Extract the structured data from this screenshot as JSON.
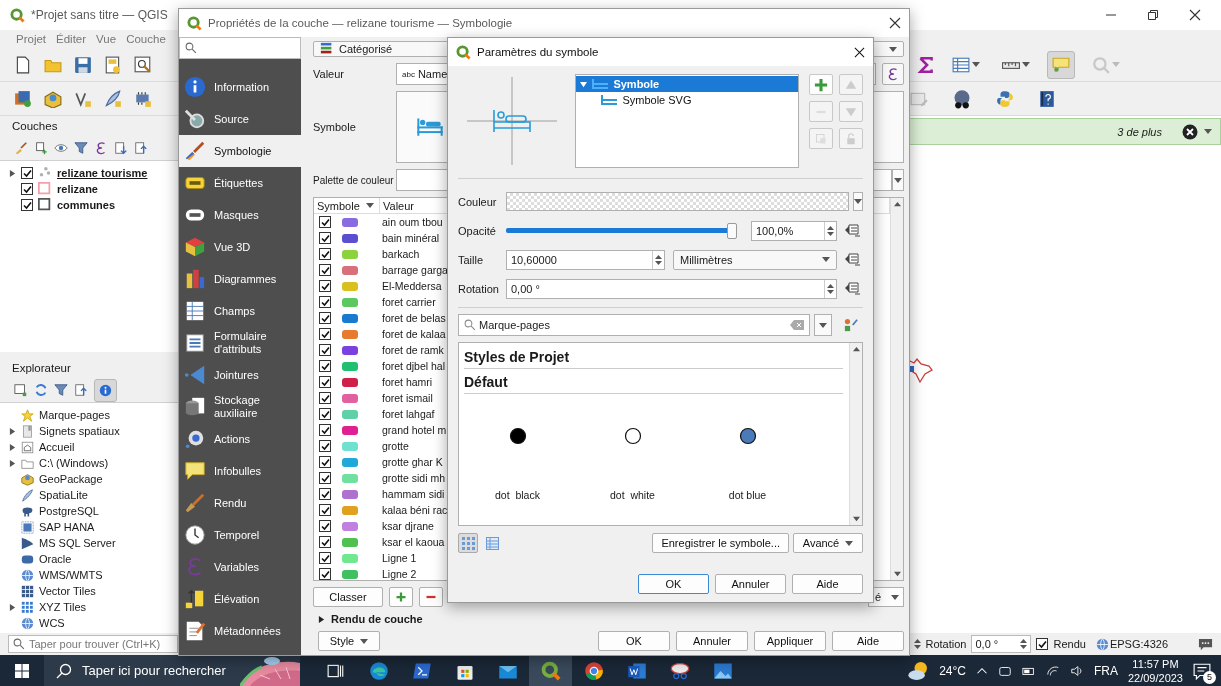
{
  "main_window": {
    "title": "*Projet sans titre — QGIS",
    "menu": [
      "Projet",
      "Éditer",
      "Vue",
      "Couche"
    ]
  },
  "layers_panel": {
    "title": "Couches",
    "layers": [
      {
        "name": "relizane tourisme",
        "checked": true,
        "expandable": true,
        "selected": true,
        "kind": "points",
        "color": "#b0b0b0"
      },
      {
        "name": "relizane",
        "checked": true,
        "expandable": false,
        "selected": false,
        "kind": "polygon",
        "color": "#f4a0a8"
      },
      {
        "name": "communes",
        "checked": true,
        "expandable": false,
        "selected": false,
        "kind": "polygon",
        "color": "#555555"
      }
    ]
  },
  "explorer_panel": {
    "title": "Explorateur",
    "items": [
      {
        "label": "Marque-pages",
        "expandable": false
      },
      {
        "label": "Signets spatiaux",
        "expandable": true
      },
      {
        "label": "Accueil",
        "expandable": true
      },
      {
        "label": "C:\\ (Windows)",
        "expandable": true
      },
      {
        "label": "GeoPackage",
        "expandable": false
      },
      {
        "label": "SpatiaLite",
        "expandable": false
      },
      {
        "label": "PostgreSQL",
        "expandable": false
      },
      {
        "label": "SAP HANA",
        "expandable": false
      },
      {
        "label": "MS SQL Server",
        "expandable": false
      },
      {
        "label": "Oracle",
        "expandable": false
      },
      {
        "label": "WMS/WMTS",
        "expandable": false
      },
      {
        "label": "Vector Tiles",
        "expandable": false
      },
      {
        "label": "XYZ Tiles",
        "expandable": true
      },
      {
        "label": "WCS",
        "expandable": false
      }
    ]
  },
  "message_bar": {
    "text": "3 de plus"
  },
  "status_bar": {
    "search_placeholder": "Taper pour trouver (Ctrl+K)",
    "rotation_label": "Rotation",
    "rotation_value": "0,0 °",
    "render_label": "Rendu",
    "render_checked": true,
    "crs": "EPSG:4326"
  },
  "layer_properties": {
    "title": "Propriétés de la couche — relizane tourisme — Symbologie",
    "nav": [
      {
        "label": "Information",
        "selected": false
      },
      {
        "label": "Source",
        "selected": false
      },
      {
        "label": "Symbologie",
        "selected": true
      },
      {
        "label": "Étiquettes",
        "selected": false
      },
      {
        "label": "Masques",
        "selected": false
      },
      {
        "label": "Vue 3D",
        "selected": false
      },
      {
        "label": "Diagrammes",
        "selected": false
      },
      {
        "label": "Champs",
        "selected": false
      },
      {
        "label": "Formulaire d'attributs",
        "selected": false
      },
      {
        "label": "Jointures",
        "selected": false
      },
      {
        "label": "Stockage auxiliaire",
        "selected": false
      },
      {
        "label": "Actions",
        "selected": false
      },
      {
        "label": "Infobulles",
        "selected": false
      },
      {
        "label": "Rendu",
        "selected": false
      },
      {
        "label": "Temporel",
        "selected": false
      },
      {
        "label": "Variables",
        "selected": false
      },
      {
        "label": "Élévation",
        "selected": false
      },
      {
        "label": "Métadonnées",
        "selected": false
      }
    ],
    "renderer": "Catégorisé",
    "value_label": "Valeur",
    "value_type": "abc",
    "value_field": "Name",
    "symbol_label": "Symbole",
    "palette_label": "Palette de couleur",
    "table": {
      "columns": [
        "Symbole",
        "Valeur"
      ],
      "rows": [
        {
          "value": "ain oum tbou",
          "checked": true,
          "color": "#8a6ae0"
        },
        {
          "value": "bain minéral",
          "checked": true,
          "color": "#5a4fd0"
        },
        {
          "value": "barkach",
          "checked": true,
          "color": "#8bd23c"
        },
        {
          "value": "barrage garga",
          "checked": true,
          "color": "#d8707a"
        },
        {
          "value": "El-Meddersa",
          "checked": true,
          "color": "#d8c020"
        },
        {
          "value": "foret carrier",
          "checked": true,
          "color": "#5cc860"
        },
        {
          "value": "foret de belas",
          "checked": true,
          "color": "#1a7ad0"
        },
        {
          "value": "foret de kalaa",
          "checked": true,
          "color": "#e87a30"
        },
        {
          "value": "foret de ramk",
          "checked": true,
          "color": "#7a40e0"
        },
        {
          "value": "foret djbel hal",
          "checked": true,
          "color": "#20c070"
        },
        {
          "value": "foret hamri",
          "checked": true,
          "color": "#d0204a"
        },
        {
          "value": "foret ismail",
          "checked": true,
          "color": "#e060a0"
        },
        {
          "value": "foret lahgaf",
          "checked": true,
          "color": "#60d0a8"
        },
        {
          "value": "grand hotel m",
          "checked": true,
          "color": "#e02090"
        },
        {
          "value": "grotte",
          "checked": true,
          "color": "#70e0d0"
        },
        {
          "value": "grotte ghar K",
          "checked": true,
          "color": "#20a8d8"
        },
        {
          "value": "grotte sidi mh",
          "checked": true,
          "color": "#70e0a0"
        },
        {
          "value": "hammam sidi",
          "checked": true,
          "color": "#b070d0"
        },
        {
          "value": "kalaa béni rac",
          "checked": true,
          "color": "#e0a020"
        },
        {
          "value": "ksar djrane",
          "checked": true,
          "color": "#c080e0"
        },
        {
          "value": "ksar el kaoua",
          "checked": true,
          "color": "#50c050"
        },
        {
          "value": "Ligne 1",
          "checked": true,
          "color": "#70e890"
        },
        {
          "value": "Ligne 2",
          "checked": true,
          "color": "#40c060"
        }
      ]
    },
    "classify_button": "Classer",
    "advanced_fragment": "é",
    "layer_rendering": "Rendu de couche",
    "style_button": "Style",
    "buttons": [
      "OK",
      "Annuler",
      "Appliquer",
      "Aide"
    ]
  },
  "symbol_dialog": {
    "title": "Paramètres du symbole",
    "layers": [
      {
        "label": "Symbole",
        "selected": true,
        "expanded": true,
        "children": [
          {
            "label": "Symbole SVG",
            "selected": false
          }
        ]
      }
    ],
    "color_label": "Couleur",
    "opacity_label": "Opacité",
    "opacity": {
      "level": 1,
      "value": "100,0%"
    },
    "size_label": "Taille",
    "size_value": "10,60000",
    "size_unit": "Millimètres",
    "rotation_label": "Rotation",
    "rotation_value": "0,00 °",
    "search_value": "Marque-pages",
    "headings": [
      "Styles de Projet",
      "Défaut"
    ],
    "symbols": [
      {
        "name": "dot  black",
        "color": "#000000"
      },
      {
        "name": "dot  white",
        "color": "#ffffff"
      },
      {
        "name": "dot blue",
        "color": "#4a7ab8"
      }
    ],
    "view_modes": [
      {
        "kind": "grid",
        "selected": true
      },
      {
        "kind": "list",
        "selected": false
      }
    ],
    "save_button": "Enregistrer le symbole...",
    "advanced_button": "Avancé",
    "buttons": [
      "OK",
      "Annuler",
      "Aide"
    ]
  },
  "taskbar": {
    "search_placeholder": "Taper ici pour rechercher",
    "apps": [
      {
        "kind": "task-view",
        "active": false
      },
      {
        "kind": "edge",
        "active": false
      },
      {
        "kind": "terminal",
        "active": false
      },
      {
        "kind": "store",
        "active": false
      },
      {
        "kind": "mail",
        "active": false
      },
      {
        "kind": "qgis",
        "active": true
      },
      {
        "kind": "chrome",
        "active": false
      },
      {
        "kind": "word",
        "active": false
      },
      {
        "kind": "snipping",
        "active": false
      },
      {
        "kind": "photos",
        "active": false
      }
    ],
    "temperature": "24°C",
    "language": "FRA",
    "time": "11:57 PM",
    "date": "22/09/2023",
    "notifications": "5"
  }
}
